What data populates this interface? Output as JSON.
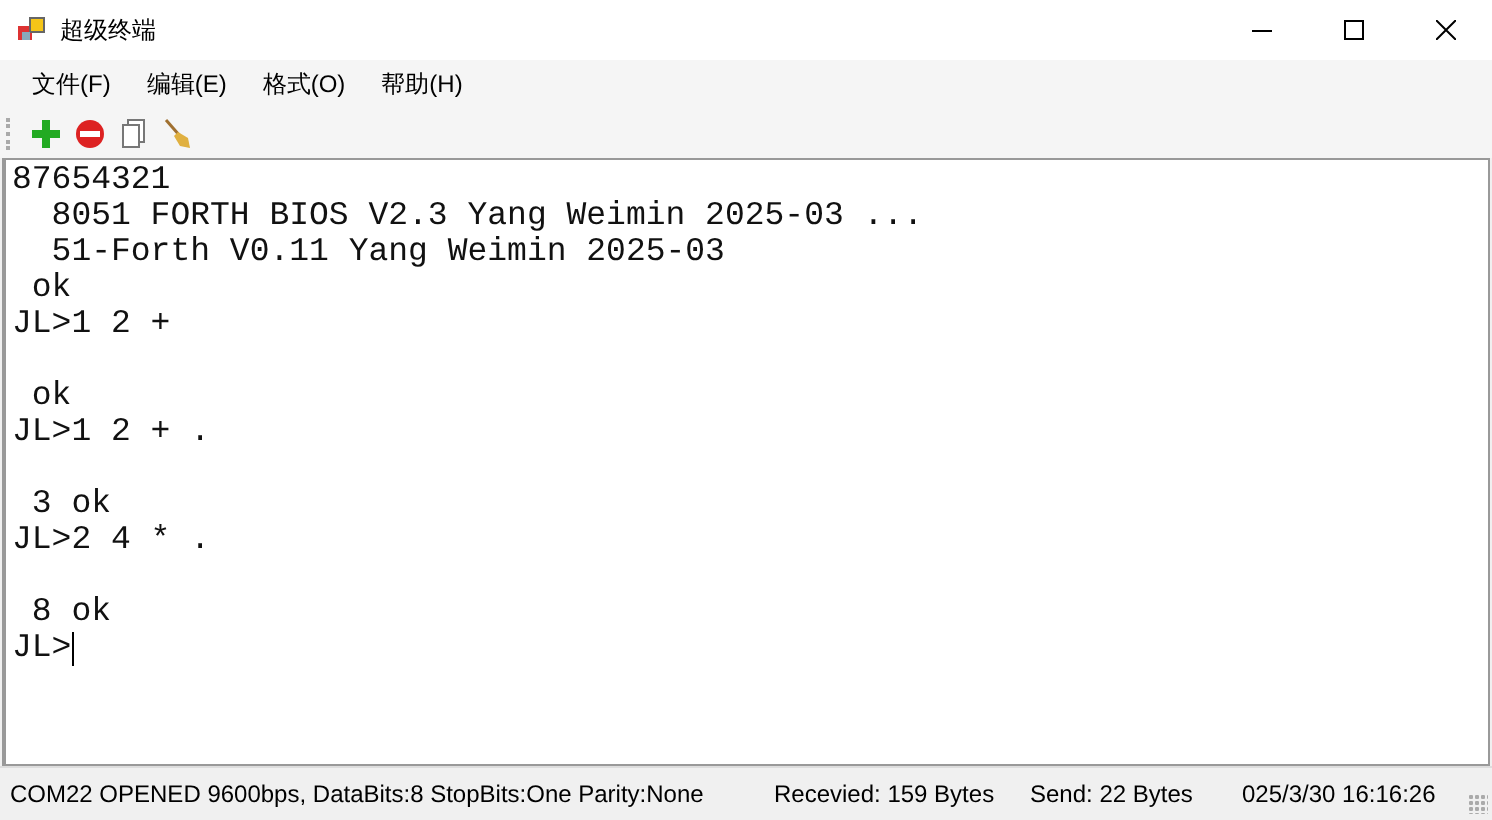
{
  "window": {
    "title": "超级终端"
  },
  "menu": [
    "文件(F)",
    "编辑(E)",
    "格式(O)",
    "帮助(H)"
  ],
  "terminal": {
    "text": "87654321\n  8051 FORTH BIOS V2.3 Yang Weimin 2025-03 ...\n  51-Forth V0.11 Yang Weimin 2025-03\n ok\nJL>1 2 +\n\n ok\nJL>1 2 + .\n\n 3 ok\nJL>2 4 * .\n\n 8 ok\nJL>",
    "cursor": true
  },
  "status_bar": [
    "COM22 OPENED 9600bps, DataBits:8 StopBits:One Parity:None",
    "Recevied: 159 Bytes",
    "Send: 22 Bytes",
    "025/3/30 16:16:26"
  ]
}
